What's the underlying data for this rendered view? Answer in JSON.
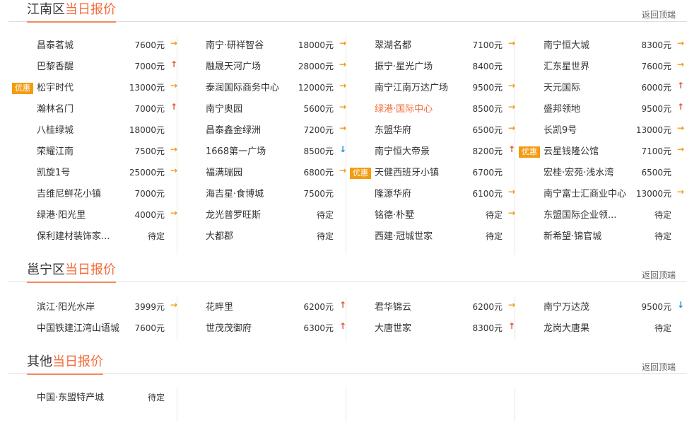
{
  "sections": [
    {
      "title_prefix": "江南区",
      "title_highlight": "当日报价",
      "back_top": "返回顶端",
      "columns": [
        [
          {
            "name": "昌泰茗城",
            "price": "7600元",
            "trend": "flat"
          },
          {
            "name": "巴黎香醍",
            "price": "7000元",
            "trend": "up"
          },
          {
            "name": "松宇时代",
            "price": "13000元",
            "trend": "flat",
            "badge": "优惠"
          },
          {
            "name": "瀚林名门",
            "price": "7000元",
            "trend": "up"
          },
          {
            "name": "八桂绿城",
            "price": "18000元",
            "trend": ""
          },
          {
            "name": "荣耀江南",
            "price": "7500元",
            "trend": "flat"
          },
          {
            "name": "凯旋1号",
            "price": "25000元",
            "trend": "flat"
          },
          {
            "name": "吉维尼鲜花小镇",
            "price": "7000元",
            "trend": ""
          },
          {
            "name": "绿港·阳光里",
            "price": "4000元",
            "trend": "flat"
          },
          {
            "name": "保利建材装饰家...",
            "price": "待定",
            "trend": ""
          }
        ],
        [
          {
            "name": "南宁·研祥智谷",
            "price": "18000元",
            "trend": "flat"
          },
          {
            "name": "融晟天河广场",
            "price": "28000元",
            "trend": "flat"
          },
          {
            "name": "泰润国际商务中心",
            "price": "12000元",
            "trend": "flat"
          },
          {
            "name": "南宁奥园",
            "price": "5600元",
            "trend": "flat"
          },
          {
            "name": "昌泰鑫金绿洲",
            "price": "7200元",
            "trend": "flat"
          },
          {
            "name": "1668第一广场",
            "price": "8500元",
            "trend": "down"
          },
          {
            "name": "福满瑞园",
            "price": "6800元",
            "trend": "flat"
          },
          {
            "name": "海吉星·食博城",
            "price": "7500元",
            "trend": ""
          },
          {
            "name": "龙光普罗旺斯",
            "price": "待定",
            "trend": ""
          },
          {
            "name": "大都郡",
            "price": "待定",
            "trend": ""
          }
        ],
        [
          {
            "name": "翠湖名都",
            "price": "7100元",
            "trend": "flat"
          },
          {
            "name": "振宁·星光广场",
            "price": "8400元",
            "trend": ""
          },
          {
            "name": "南宁江南万达广场",
            "price": "9500元",
            "trend": "flat"
          },
          {
            "name": "绿港·国际中心",
            "price": "8500元",
            "trend": "flat",
            "highlight": true
          },
          {
            "name": "东盟华府",
            "price": "6500元",
            "trend": "flat"
          },
          {
            "name": "南宁恒大帝景",
            "price": "8200元",
            "trend": "up"
          },
          {
            "name": "天健西班牙小镇",
            "price": "6700元",
            "trend": "",
            "badge": "优惠"
          },
          {
            "name": "隆源华府",
            "price": "6100元",
            "trend": "flat"
          },
          {
            "name": "铭德·朴墅",
            "price": "待定",
            "trend": "flat"
          },
          {
            "name": "西建·冠城世家",
            "price": "待定",
            "trend": ""
          }
        ],
        [
          {
            "name": "南宁恒大城",
            "price": "8300元",
            "trend": "flat"
          },
          {
            "name": "汇东星世界",
            "price": "7600元",
            "trend": "flat"
          },
          {
            "name": "天元国际",
            "price": "6000元",
            "trend": "up"
          },
          {
            "name": "盛邦领地",
            "price": "9500元",
            "trend": "up"
          },
          {
            "name": "长凯9号",
            "price": "13000元",
            "trend": "flat"
          },
          {
            "name": "云星钱隆公馆",
            "price": "7100元",
            "trend": "flat",
            "badge": "优惠"
          },
          {
            "name": "宏桂·宏苑·浅水湾",
            "price": "6500元",
            "trend": ""
          },
          {
            "name": "南宁富士汇商业中心",
            "price": "13000元",
            "trend": "flat"
          },
          {
            "name": "东盟国际企业领...",
            "price": "待定",
            "trend": ""
          },
          {
            "name": "新希望·锦官城",
            "price": "待定",
            "trend": ""
          }
        ]
      ]
    },
    {
      "title_prefix": "邕宁区",
      "title_highlight": "当日报价",
      "back_top": "返回顶端",
      "columns": [
        [
          {
            "name": "滨江·阳光水岸",
            "price": "3999元",
            "trend": "flat"
          },
          {
            "name": "中国铁建江湾山语城",
            "price": "7600元",
            "trend": ""
          }
        ],
        [
          {
            "name": "花畔里",
            "price": "6200元",
            "trend": "up"
          },
          {
            "name": "世茂茂御府",
            "price": "6300元",
            "trend": "up"
          }
        ],
        [
          {
            "name": "君华锦云",
            "price": "6200元",
            "trend": "flat"
          },
          {
            "name": "大唐世家",
            "price": "8300元",
            "trend": "up"
          }
        ],
        [
          {
            "name": "南宁万达茂",
            "price": "9500元",
            "trend": "down"
          },
          {
            "name": "龙岗大唐果",
            "price": "待定",
            "trend": ""
          }
        ]
      ]
    },
    {
      "title_prefix": "其他",
      "title_highlight": "当日报价",
      "back_top": "返回顶端",
      "columns": [
        [
          {
            "name": "中国·东盟特产城",
            "price": "待定",
            "trend": ""
          }
        ],
        [],
        [],
        []
      ]
    }
  ],
  "trend_icons": {
    "flat": "→",
    "up": "↑",
    "down": "↓"
  }
}
